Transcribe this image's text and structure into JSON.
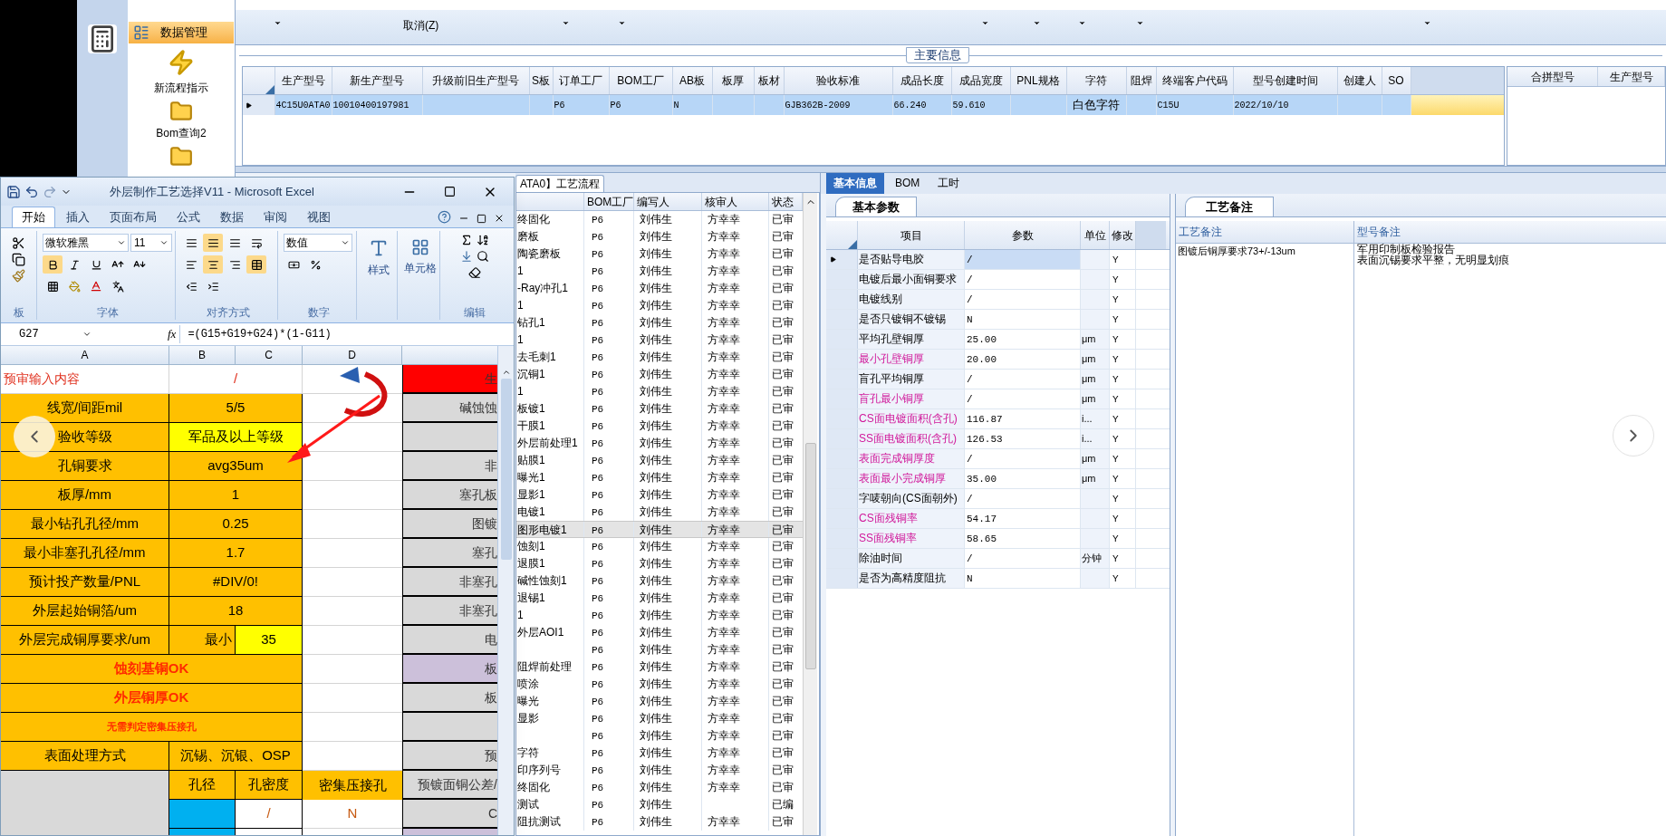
{
  "sidebar": {
    "items": [
      {
        "kind": "menu",
        "label": "数据管理",
        "selected": true
      },
      {
        "kind": "bolt",
        "label": "新流程指示",
        "selected": false
      },
      {
        "kind": "folder",
        "label": "Bom查询2",
        "selected": false
      },
      {
        "kind": "folder",
        "selected": false
      }
    ]
  },
  "toolbar": {
    "cancel": "取消(Z)"
  },
  "main_info": {
    "title": "主要信息",
    "row_selected": true,
    "columns": [
      {
        "label": "生产型号",
        "value": "4C15U0ATA0"
      },
      {
        "label": "新生产型号",
        "value": "10010400197981"
      },
      {
        "label": "升级前旧生产型号"
      },
      {
        "label": "S板"
      },
      {
        "label": "订单工厂",
        "value": "P6"
      },
      {
        "label": "BOM工厂",
        "value": "P6"
      },
      {
        "label": "AB板",
        "value": "N"
      },
      {
        "label": "板厚"
      },
      {
        "label": "板材"
      },
      {
        "label": "验收标准",
        "value": "GJB362B-2009"
      },
      {
        "label": "成品长度",
        "value": "66.240"
      },
      {
        "label": "成品宽度",
        "value": "59.610"
      },
      {
        "label": "PNL规格"
      },
      {
        "label": "字符",
        "value": "白色字符"
      },
      {
        "label": "阻焊"
      },
      {
        "label": "终端客户代码",
        "value": "C15U"
      },
      {
        "label": "型号创建时间",
        "value": "2022/10/10"
      },
      {
        "label": "创建人"
      },
      {
        "label": "SO"
      }
    ]
  },
  "merge_panel": {
    "columns": [
      "合拼型号",
      "生产型号"
    ]
  },
  "process_tab": "ATA0】工艺流程",
  "process_list": {
    "columns": [
      "BOM工厂",
      "编写人",
      "核审人",
      "状态"
    ],
    "rows": [
      {
        "name": "终固化",
        "bom": "P6",
        "writer": "刘伟生",
        "reviewer": "方幸幸",
        "status": "已审",
        "selected": false
      },
      {
        "name": "磨板",
        "bom": "P6",
        "writer": "刘伟生",
        "reviewer": "方幸幸",
        "status": "已审",
        "selected": false
      },
      {
        "name": "陶瓷磨板",
        "bom": "P6",
        "writer": "刘伟生",
        "reviewer": "方幸幸",
        "status": "已审",
        "selected": false
      },
      {
        "name": "1",
        "bom": "P6",
        "writer": "刘伟生",
        "reviewer": "方幸幸",
        "status": "已审",
        "selected": false
      },
      {
        "name": "-Ray冲孔1",
        "bom": "P6",
        "writer": "刘伟生",
        "reviewer": "方幸幸",
        "status": "已审",
        "selected": false
      },
      {
        "name": "1",
        "bom": "P6",
        "writer": "刘伟生",
        "reviewer": "方幸幸",
        "status": "已审",
        "selected": false
      },
      {
        "name": "钻孔1",
        "bom": "P6",
        "writer": "刘伟生",
        "reviewer": "方幸幸",
        "status": "已审",
        "selected": false
      },
      {
        "name": "1",
        "bom": "P6",
        "writer": "刘伟生",
        "reviewer": "方幸幸",
        "status": "已审",
        "selected": false
      },
      {
        "name": "去毛刺1",
        "bom": "P6",
        "writer": "刘伟生",
        "reviewer": "方幸幸",
        "status": "已审",
        "selected": false
      },
      {
        "name": "沉铜1",
        "bom": "P6",
        "writer": "刘伟生",
        "reviewer": "方幸幸",
        "status": "已审",
        "selected": false
      },
      {
        "name": "1",
        "bom": "P6",
        "writer": "刘伟生",
        "reviewer": "方幸幸",
        "status": "已审",
        "selected": false
      },
      {
        "name": "板镀1",
        "bom": "P6",
        "writer": "刘伟生",
        "reviewer": "方幸幸",
        "status": "已审",
        "selected": false
      },
      {
        "name": "干膜1",
        "bom": "P6",
        "writer": "刘伟生",
        "reviewer": "方幸幸",
        "status": "已审",
        "selected": false
      },
      {
        "name": "外层前处理1",
        "bom": "P6",
        "writer": "刘伟生",
        "reviewer": "方幸幸",
        "status": "已审",
        "selected": false
      },
      {
        "name": "贴膜1",
        "bom": "P6",
        "writer": "刘伟生",
        "reviewer": "方幸幸",
        "status": "已审",
        "selected": false
      },
      {
        "name": "曝光1",
        "bom": "P6",
        "writer": "刘伟生",
        "reviewer": "方幸幸",
        "status": "已审",
        "selected": false
      },
      {
        "name": "显影1",
        "bom": "P6",
        "writer": "刘伟生",
        "reviewer": "方幸幸",
        "status": "已审",
        "selected": false
      },
      {
        "name": "电镀1",
        "bom": "P6",
        "writer": "刘伟生",
        "reviewer": "方幸幸",
        "status": "已审",
        "selected": false
      },
      {
        "name": "图形电镀1",
        "bom": "P6",
        "writer": "刘伟生",
        "reviewer": "方幸幸",
        "status": "已审",
        "selected": true
      },
      {
        "name": "蚀刻1",
        "bom": "P6",
        "writer": "刘伟生",
        "reviewer": "方幸幸",
        "status": "已审",
        "selected": false
      },
      {
        "name": "退膜1",
        "bom": "P6",
        "writer": "刘伟生",
        "reviewer": "方幸幸",
        "status": "已审",
        "selected": false
      },
      {
        "name": "碱性蚀刻1",
        "bom": "P6",
        "writer": "刘伟生",
        "reviewer": "方幸幸",
        "status": "已审",
        "selected": false
      },
      {
        "name": "退锡1",
        "bom": "P6",
        "writer": "刘伟生",
        "reviewer": "方幸幸",
        "status": "已审",
        "selected": false
      },
      {
        "name": "1",
        "bom": "P6",
        "writer": "刘伟生",
        "reviewer": "方幸幸",
        "status": "已审",
        "selected": false
      },
      {
        "name": "外层AOI1",
        "bom": "P6",
        "writer": "刘伟生",
        "reviewer": "方幸幸",
        "status": "已审",
        "selected": false
      },
      {
        "bom": "P6",
        "writer": "刘伟生",
        "reviewer": "方幸幸",
        "status": "已审",
        "selected": false
      },
      {
        "name": "阻焊前处理",
        "bom": "P6",
        "writer": "刘伟生",
        "reviewer": "方幸幸",
        "status": "已审",
        "selected": false
      },
      {
        "name": "喷涂",
        "bom": "P6",
        "writer": "刘伟生",
        "reviewer": "方幸幸",
        "status": "已审",
        "selected": false
      },
      {
        "name": "曝光",
        "bom": "P6",
        "writer": "刘伟生",
        "reviewer": "方幸幸",
        "status": "已审",
        "selected": false
      },
      {
        "name": "显影",
        "bom": "P6",
        "writer": "刘伟生",
        "reviewer": "方幸幸",
        "status": "已审",
        "selected": false
      },
      {
        "bom": "P6",
        "writer": "刘伟生",
        "reviewer": "方幸幸",
        "status": "已审",
        "selected": false
      },
      {
        "name": "字符",
        "bom": "P6",
        "writer": "刘伟生",
        "reviewer": "方幸幸",
        "status": "已审",
        "selected": false
      },
      {
        "name": "印序列号",
        "bom": "P6",
        "writer": "刘伟生",
        "reviewer": "方幸幸",
        "status": "已审",
        "selected": false
      },
      {
        "name": "终固化",
        "bom": "P6",
        "writer": "刘伟生",
        "reviewer": "方幸幸",
        "status": "已审",
        "selected": false
      },
      {
        "name": "测试",
        "bom": "P6",
        "writer": "刘伟生",
        "status": "已编",
        "selected": false
      },
      {
        "name": "阻抗测试",
        "bom": "P6",
        "writer": "刘伟生",
        "reviewer": "方幸幸",
        "status": "已审",
        "selected": false
      }
    ]
  },
  "detail_tabs": [
    {
      "label": "基本信息",
      "selected": true
    },
    {
      "label": "BOM",
      "selected": false
    },
    {
      "label": "工时",
      "selected": false
    }
  ],
  "params": {
    "tab": "基本参数",
    "columns": [
      "项目",
      "参数",
      "单位",
      "修改"
    ],
    "rows": [
      {
        "item": "是否贴导电胶",
        "value": "/",
        "edit": "Y",
        "highlighted": false,
        "selected": true
      },
      {
        "item": "电镀后最小面铜要求",
        "value": "/",
        "edit": "Y",
        "highlighted": false,
        "selected": false
      },
      {
        "item": "电镀线别",
        "value": "/",
        "edit": "Y",
        "highlighted": false,
        "selected": false
      },
      {
        "item": "是否只镀铜不镀锡",
        "value": "N",
        "edit": "Y",
        "highlighted": false,
        "selected": false
      },
      {
        "item": "平均孔壁铜厚",
        "value": "25.00",
        "unit": "μm",
        "edit": "Y",
        "highlighted": false,
        "selected": false
      },
      {
        "item": "最小孔壁铜厚",
        "value": "20.00",
        "unit": "μm",
        "edit": "Y",
        "highlighted": true,
        "selected": false
      },
      {
        "item": "盲孔平均铜厚",
        "value": "/",
        "unit": "μm",
        "edit": "Y",
        "highlighted": false,
        "selected": false
      },
      {
        "item": "盲孔最小铜厚",
        "value": "/",
        "unit": "μm",
        "edit": "Y",
        "highlighted": true,
        "selected": false
      },
      {
        "item": "CS面电镀面积(含孔)",
        "value": "116.87",
        "unit": "i...",
        "edit": "Y",
        "highlighted": true,
        "selected": false
      },
      {
        "item": "SS面电镀面积(含孔)",
        "value": "126.53",
        "unit": "i...",
        "edit": "Y",
        "highlighted": true,
        "selected": false
      },
      {
        "item": "表面完成铜厚度",
        "value": "/",
        "unit": "μm",
        "edit": "Y",
        "highlighted": true,
        "selected": false
      },
      {
        "item": "表面最小完成铜厚",
        "value": "35.00",
        "unit": "μm",
        "edit": "Y",
        "highlighted": true,
        "selected": false
      },
      {
        "item": "字唛朝向(CS面朝外)",
        "value": "/",
        "edit": "Y",
        "highlighted": false,
        "selected": false
      },
      {
        "item": "CS面残铜率",
        "value": "54.17",
        "edit": "Y",
        "highlighted": true,
        "selected": false
      },
      {
        "item": "SS面残铜率",
        "value": "58.65",
        "edit": "Y",
        "highlighted": true,
        "selected": false
      },
      {
        "item": "除油时间",
        "value": "/",
        "unit": "分钟",
        "edit": "Y",
        "highlighted": false,
        "selected": false
      },
      {
        "item": "是否为高精度阻抗",
        "value": "N",
        "edit": "Y",
        "highlighted": false,
        "selected": false
      }
    ]
  },
  "notes": {
    "tab": "工艺备注",
    "columns": [
      "工艺备注",
      "型号备注"
    ],
    "process_note": "图镀后铜厚要求73+/-13um",
    "model_note": [
      "军用印制板检验报告",
      "表面沉锡要求平整，无明显划痕"
    ]
  },
  "excel": {
    "title": "外层制作工艺选择V11 - Microsoft Excel",
    "ribbon_tabs": [
      {
        "label": "开始",
        "selected": true
      },
      {
        "label": "插入",
        "selected": false
      },
      {
        "label": "页面布局",
        "selected": false
      },
      {
        "label": "公式",
        "selected": false
      },
      {
        "label": "数据",
        "selected": false
      },
      {
        "label": "审阅",
        "selected": false
      },
      {
        "label": "视图",
        "selected": false
      }
    ],
    "font": "微软雅黑",
    "size": "11",
    "number_format": "数值",
    "styles": "样式",
    "cells": "单元格",
    "groups": [
      "板",
      "字体",
      "对齐方式",
      "数字",
      "编辑"
    ],
    "name_box": "G27",
    "fx": "fx",
    "formula": "=(G15+G19+G24)*(1-G11)",
    "columns": [
      "A",
      "B",
      "C",
      "D"
    ],
    "rows": [
      {
        "kind": "input",
        "label": "预审输入内容",
        "value": "/",
        "side": "生",
        "color": "#ff0000"
      },
      {
        "kind": "pair",
        "label": "线宽/间距mil",
        "value": "5/5",
        "highlighted": false,
        "side": "碱蚀蚀",
        "color": "#d9d9d9"
      },
      {
        "kind": "pair",
        "label": "验收等级",
        "value": "军品及以上等级",
        "highlighted": true,
        "color": "#d9d9d9"
      },
      {
        "kind": "pair",
        "label": "孔铜要求",
        "value": "avg35um",
        "highlighted": false,
        "side": "非",
        "color": "#d9d9d9"
      },
      {
        "kind": "pair",
        "label": "板厚/mm",
        "value": "1",
        "highlighted": false,
        "side": "塞孔板",
        "color": "#d9d9d9"
      },
      {
        "kind": "pair",
        "label": "最小钻孔孔径/mm",
        "value": "0.25",
        "highlighted": false,
        "side": "图镀",
        "color": "#d9d9d9"
      },
      {
        "kind": "pair",
        "label": "最小非塞孔孔径/mm",
        "value": "1.7",
        "highlighted": false,
        "side": "塞孔",
        "color": "#d9d9d9"
      },
      {
        "kind": "pair",
        "label": "预计投产数量/PNL",
        "value": "#DIV/0!",
        "highlighted": false,
        "side": "非塞孔",
        "color": "#d9d9d9"
      },
      {
        "kind": "pair",
        "label": "外层起始铜箔/um",
        "value": "18",
        "highlighted": false,
        "side": "非塞孔",
        "color": "#d9d9d9"
      },
      {
        "kind": "split",
        "label": "外层完成铜厚要求/um",
        "value": "最小",
        "extra": "35",
        "side": "电",
        "color": "#d9d9d9"
      },
      {
        "kind": "banner",
        "text": "蚀刻基铜OK",
        "small": false,
        "side": "板",
        "color": "#ccc0da"
      },
      {
        "kind": "banner",
        "text": "外层铜厚OK",
        "small": false,
        "side": "板",
        "color": "#d9d9d9"
      },
      {
        "kind": "banner",
        "text": "无需判定密集压接孔",
        "small": true,
        "color": "#d9d9d9"
      },
      {
        "kind": "pair",
        "label": "表面处理方式",
        "value": "沉锡、沉银、OSP",
        "highlighted": false,
        "side": "预",
        "color": "#d9d9d9"
      },
      {
        "kind": "header",
        "cols": [
          "孔径",
          "孔密度",
          "密集压接孔"
        ],
        "side": "预镀面铜公差/",
        "color": "#d9d9d9"
      },
      {
        "kind": "data",
        "density": "/",
        "press": "N",
        "side": "C",
        "color": "#d9d9d9"
      },
      {
        "kind": "data",
        "color": "#ccc0da"
      }
    ]
  }
}
